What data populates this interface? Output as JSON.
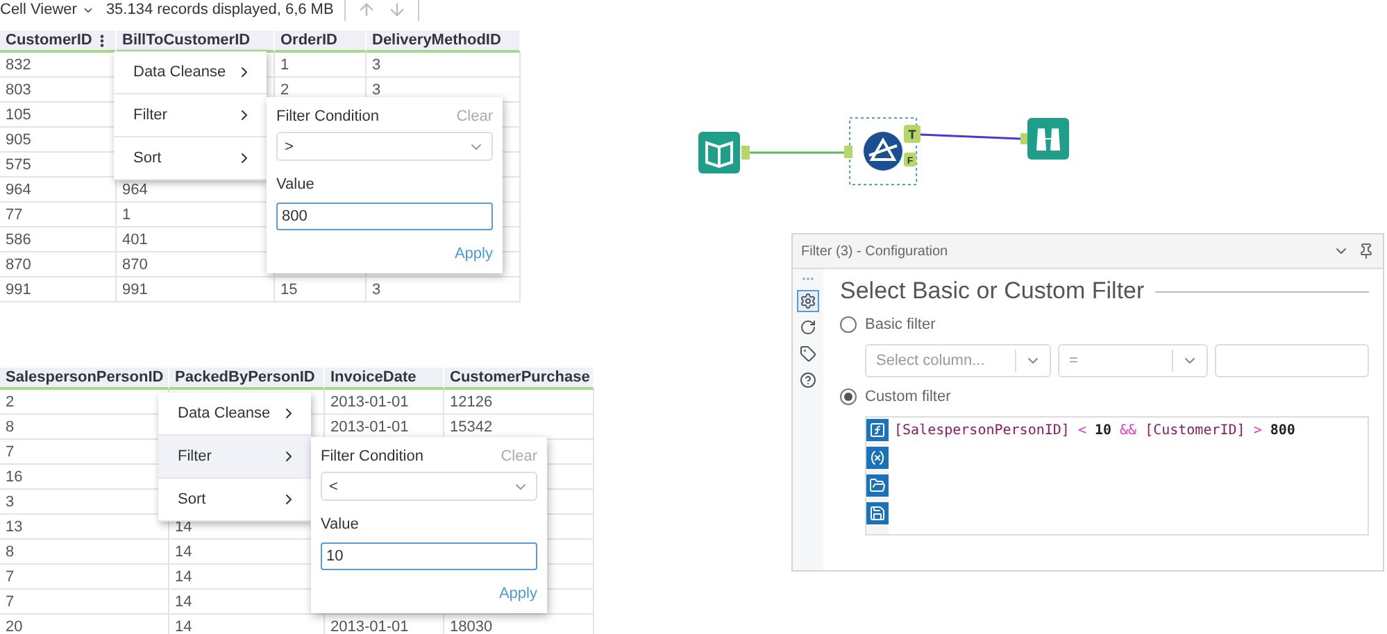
{
  "cell_viewer": {
    "title": "Cell Viewer",
    "summary": "35.134 records displayed, 6,6 MB"
  },
  "grids": [
    {
      "columns": [
        "CustomerID",
        "BillToCustomerID",
        "OrderID",
        "DeliveryMethodID"
      ],
      "rows": [
        [
          "832",
          null,
          "1",
          "3"
        ],
        [
          "803",
          null,
          "2",
          "3"
        ],
        [
          "105",
          null,
          null,
          null
        ],
        [
          "905",
          null,
          null,
          null
        ],
        [
          "575",
          null,
          null,
          null
        ],
        [
          "964",
          "964",
          null,
          null
        ],
        [
          "77",
          "1",
          null,
          null
        ],
        [
          "586",
          "401",
          null,
          null
        ],
        [
          "870",
          "870",
          null,
          null
        ],
        [
          "991",
          "991",
          "15",
          "3"
        ]
      ],
      "menu": [
        {
          "label": "Data Cleanse",
          "selected": false
        },
        {
          "label": "Filter",
          "selected": false
        },
        {
          "label": "Sort",
          "selected": false
        }
      ],
      "popup": {
        "title": "Filter Condition",
        "clear": "Clear",
        "condition": ">",
        "value_label": "Value",
        "value": "800",
        "apply": "Apply"
      }
    },
    {
      "columns": [
        "SalespersonPersonID",
        "PackedByPersonID",
        "InvoiceDate",
        "CustomerPurchase"
      ],
      "rows": [
        [
          "2",
          null,
          "2013-01-01",
          "12126"
        ],
        [
          "8",
          null,
          "2013-01-01",
          "15342"
        ],
        [
          "7",
          null,
          null,
          null
        ],
        [
          "16",
          null,
          null,
          null
        ],
        [
          "3",
          null,
          null,
          null
        ],
        [
          "13",
          "14",
          null,
          null
        ],
        [
          "8",
          "14",
          null,
          null
        ],
        [
          "7",
          "14",
          null,
          null
        ],
        [
          "7",
          "14",
          null,
          null
        ],
        [
          "20",
          "14",
          "2013-01-01",
          "18030"
        ]
      ],
      "menu": [
        {
          "label": "Data Cleanse",
          "selected": false
        },
        {
          "label": "Filter",
          "selected": true
        },
        {
          "label": "Sort",
          "selected": false
        }
      ],
      "popup": {
        "title": "Filter Condition",
        "clear": "Clear",
        "condition": "<",
        "value_label": "Value",
        "value": "10",
        "apply": "Apply"
      }
    }
  ],
  "workflow": {
    "tools": [
      {
        "kind": "input",
        "selected": false
      },
      {
        "kind": "filter",
        "selected": true,
        "anchors": [
          "T",
          "F"
        ]
      },
      {
        "kind": "browse",
        "selected": false
      }
    ]
  },
  "configuration": {
    "title": "Filter (3) - Configuration",
    "side_tabs": [
      {
        "kind": "settings",
        "selected": true
      },
      {
        "kind": "connections",
        "selected": false
      },
      {
        "kind": "annotation",
        "selected": false
      },
      {
        "kind": "help",
        "selected": false
      }
    ],
    "heading": "Select Basic or Custom Filter",
    "options": [
      {
        "label": "Basic filter",
        "selected": false
      },
      {
        "label": "Custom filter",
        "selected": true
      }
    ],
    "basic": {
      "column_placeholder": "Select column...",
      "operator": "="
    },
    "expression": [
      {
        "kind": "field",
        "text": "[SalespersonPersonID]"
      },
      {
        "kind": "operator",
        "text": "<"
      },
      {
        "kind": "number",
        "text": "10"
      },
      {
        "kind": "operator",
        "text": "&&"
      },
      {
        "kind": "field",
        "text": "[CustomerID]"
      },
      {
        "kind": "operator",
        "text": ">"
      },
      {
        "kind": "number",
        "text": "800"
      }
    ]
  }
}
